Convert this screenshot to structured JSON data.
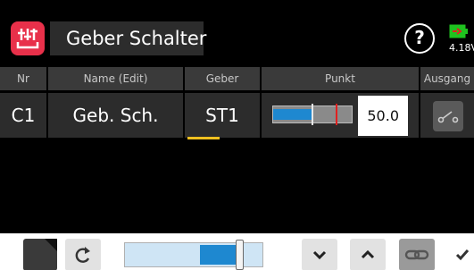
{
  "header": {
    "title": "Geber Schalter",
    "voltage": "4.18V",
    "icons": {
      "app": "mixer-sliders-icon",
      "help": "question-circle-icon",
      "battery": "battery-icon"
    },
    "help_glyph": "?"
  },
  "columns": [
    "Nr",
    "Name (Edit)",
    "Geber",
    "Punkt",
    "Ausgang"
  ],
  "rows": [
    {
      "nr": "C1",
      "name": "Geb. Sch.",
      "geber": "ST1",
      "punkt_value": "50.0",
      "punkt_bar_fill": 0.5,
      "ausgang_icon": "switch-open-icon"
    }
  ],
  "toolbar": {
    "icons": [
      "corner-triangle-icon",
      "reset-icon",
      "slider",
      "chevron-down-icon",
      "chevron-up-icon",
      "link-icon",
      "checkmark-icon"
    ],
    "slider_level": 0.83
  },
  "colors": {
    "accent_red": "#e8304a",
    "bar_blue": "#1e88d0",
    "underline_yellow": "#f0c020",
    "battery_green": "#1fc21f"
  }
}
